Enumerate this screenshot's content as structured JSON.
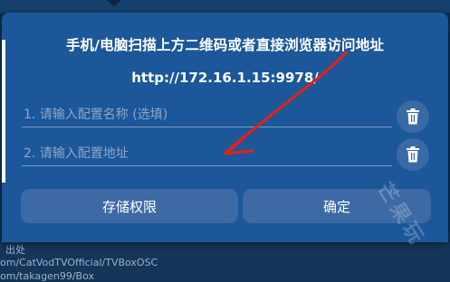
{
  "dialog": {
    "instruction": "手机/电脑扫描上方二维码或者直接浏览器访问地址",
    "url": "http://172.16.1.15:9978/",
    "fields": [
      {
        "placeholder": "1. 请输入配置名称 (选填)",
        "value": ""
      },
      {
        "placeholder": "2. 请输入配置地址",
        "value": ""
      }
    ],
    "buttons": {
      "save_permission": "存储权限",
      "confirm": "确定"
    },
    "icons": {
      "delete": "trash-icon",
      "annotation": "red-arrow-annotation"
    },
    "watermark": "芒果玩"
  },
  "background": {
    "lines": [
      "出处",
      "om/CatVodTVOfficial/TVBoxOSC",
      "om/takagen99/Box"
    ]
  },
  "colors": {
    "dialog_bg": "#1c579a",
    "button_bg": "#3d6aa5",
    "annotation": "#e0221b"
  }
}
